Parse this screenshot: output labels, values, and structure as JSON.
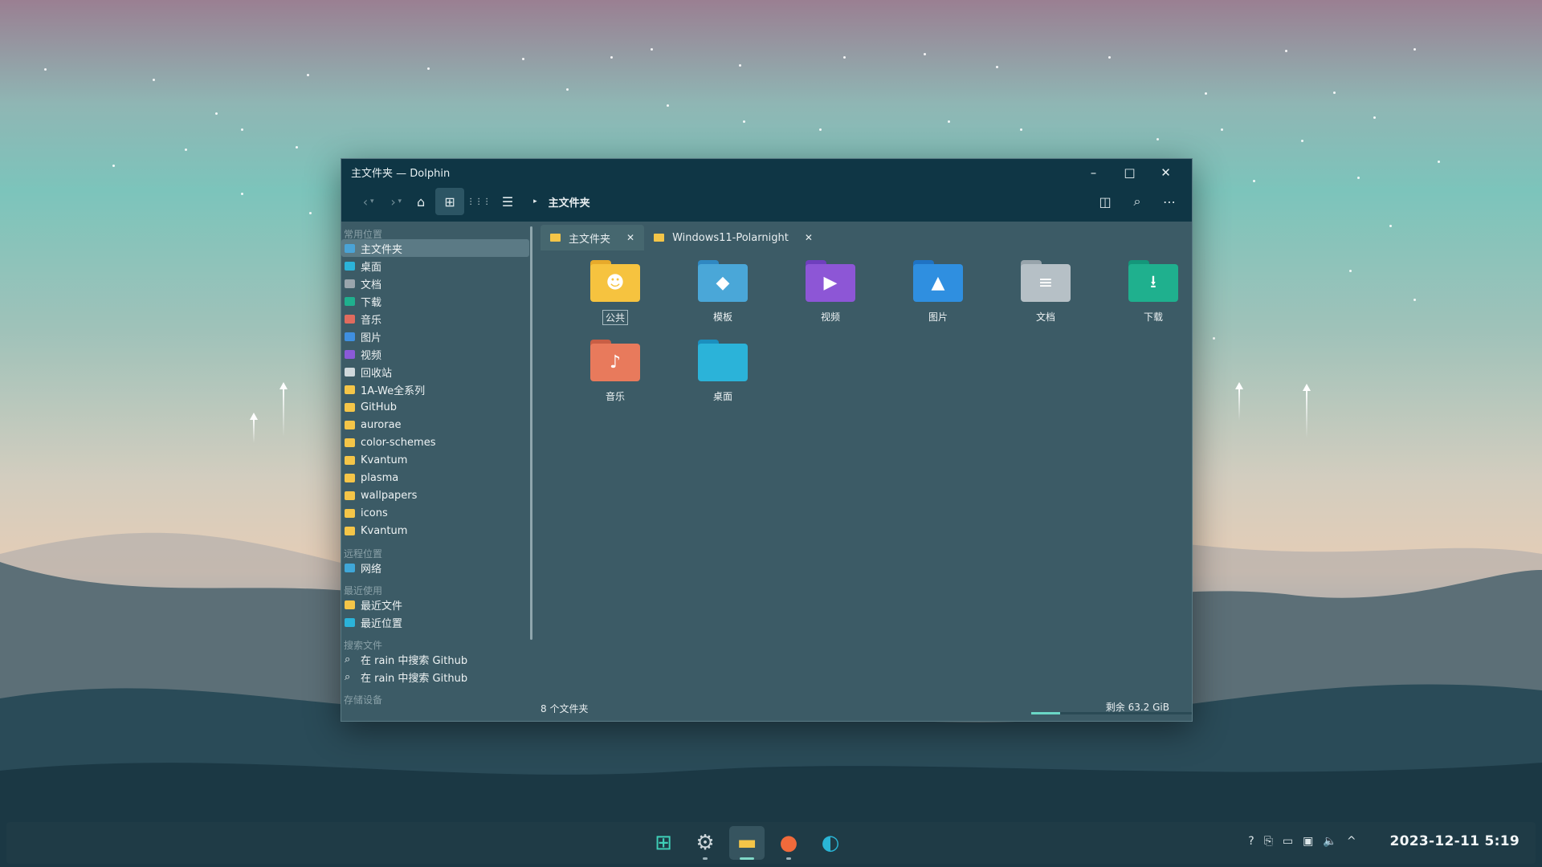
{
  "window": {
    "title": "主文件夹 — Dolphin",
    "controls": {
      "minimize": "–",
      "maximize": "□",
      "close": "✕"
    }
  },
  "toolbar": {
    "back": "‹",
    "forward": "›",
    "dropdown": "▾",
    "home": "⌂",
    "icons_view": "⊞",
    "compact_view": "⋮⋮⋮",
    "details_view": "☰",
    "breadcrumb_sep": "▸",
    "breadcrumb": "主文件夹",
    "split": "◫",
    "search": "⌕",
    "menu": "⋯"
  },
  "sidebar": {
    "sections": [
      {
        "title": "常用位置",
        "items": [
          {
            "label": "主文件夹",
            "color": "#4aa3d6",
            "selected": true
          },
          {
            "label": "桌面",
            "color": "#2bb3d9"
          },
          {
            "label": "文档",
            "color": "#9aa5ad"
          },
          {
            "label": "下载",
            "color": "#1fb08e"
          },
          {
            "label": "音乐",
            "color": "#e06b5e"
          },
          {
            "label": "图片",
            "color": "#3f8fe0"
          },
          {
            "label": "视频",
            "color": "#8a5ad8"
          },
          {
            "label": "回收站",
            "color": "#cfd8dc"
          },
          {
            "label": "1A-We全系列",
            "color": "#f4c548"
          },
          {
            "label": "GitHub",
            "color": "#f4c548"
          },
          {
            "label": "aurorae",
            "color": "#f4c548"
          },
          {
            "label": "color-schemes",
            "color": "#f4c548"
          },
          {
            "label": "Kvantum",
            "color": "#f4c548"
          },
          {
            "label": "plasma",
            "color": "#f4c548"
          },
          {
            "label": "wallpapers",
            "color": "#f4c548"
          },
          {
            "label": "icons",
            "color": "#f4c548"
          },
          {
            "label": "Kvantum",
            "color": "#f4c548"
          }
        ]
      },
      {
        "title": "远程位置",
        "items": [
          {
            "label": "网络",
            "color": "#3fa7d8"
          }
        ]
      },
      {
        "title": "最近使用",
        "items": [
          {
            "label": "最近文件",
            "color": "#f4c548"
          },
          {
            "label": "最近位置",
            "color": "#2bb3d9"
          }
        ]
      },
      {
        "title": "搜索文件",
        "items": [
          {
            "label": "在 rain 中搜索 Github",
            "icon": "⌕"
          },
          {
            "label": "在 rain 中搜索 Github",
            "icon": "⌕"
          }
        ]
      },
      {
        "title": "存储设备",
        "items": []
      }
    ]
  },
  "tabs": [
    {
      "label": "主文件夹",
      "close": "✕",
      "active": true
    },
    {
      "label": "Windows11-Polarnight",
      "close": "✕",
      "active": false
    }
  ],
  "folders": [
    {
      "label": "公共",
      "color": "#f6c33f",
      "tab_color": "#e7aa2b",
      "glyph": "☻",
      "focused": true
    },
    {
      "label": "模板",
      "color": "#4aa7d8",
      "tab_color": "#2f88c2",
      "glyph": "◆"
    },
    {
      "label": "视频",
      "color": "#8d56d6",
      "tab_color": "#6f3fbd",
      "glyph": "▶"
    },
    {
      "label": "图片",
      "color": "#2f8fe0",
      "tab_color": "#1f73c4",
      "glyph": "▲"
    },
    {
      "label": "文档",
      "color": "#b6c0c6",
      "tab_color": "#98a4ab",
      "glyph": "≡"
    },
    {
      "label": "下载",
      "color": "#1fb08e",
      "tab_color": "#14967a",
      "glyph": "⭳"
    },
    {
      "label": "音乐",
      "color": "#e87a5c",
      "tab_color": "#c85e45",
      "glyph": "♪"
    },
    {
      "label": "桌面",
      "color": "#2bb3d9",
      "tab_color": "#1b8fbe",
      "glyph": ""
    }
  ],
  "status": {
    "count": "8 个文件夹",
    "free": "剩余 63.2 GiB",
    "used_fraction": 0.18
  },
  "taskbar": {
    "apps": [
      {
        "name": "start-menu-icon",
        "glyph": "⊞",
        "color": "#3fd0b8",
        "active": false,
        "running": false
      },
      {
        "name": "settings-icon",
        "glyph": "⚙",
        "color": "#cfd8dc",
        "active": false,
        "running": true
      },
      {
        "name": "dolphin-icon",
        "glyph": "▬",
        "color": "#f4c548",
        "active": true,
        "running": true
      },
      {
        "name": "firefox-icon",
        "glyph": "●",
        "color": "#f06a3b",
        "active": false,
        "running": true
      },
      {
        "name": "edge-icon",
        "glyph": "◐",
        "color": "#2ab5d6",
        "active": false,
        "running": false
      }
    ],
    "tray": [
      "?",
      "⎘",
      "▭",
      "▣",
      "🔈",
      "^"
    ],
    "clock": "2023-12-11  5:19"
  }
}
